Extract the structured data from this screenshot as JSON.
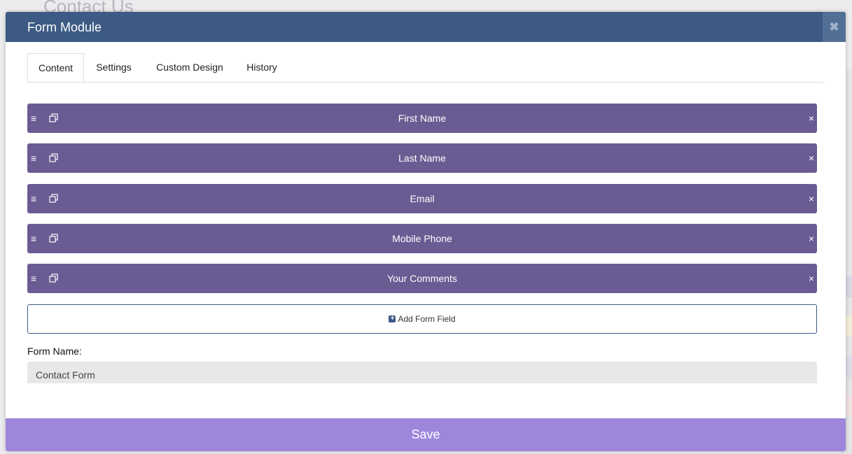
{
  "background": {
    "page_title": "Contact Us"
  },
  "modal": {
    "title": "Form Module",
    "close_label": "✖"
  },
  "tabs": [
    {
      "label": "Content",
      "active": true
    },
    {
      "label": "Settings",
      "active": false
    },
    {
      "label": "Custom Design",
      "active": false
    },
    {
      "label": "History",
      "active": false
    }
  ],
  "fields": [
    {
      "label": "First Name"
    },
    {
      "label": "Last Name"
    },
    {
      "label": "Email"
    },
    {
      "label": "Mobile Phone"
    },
    {
      "label": "Your Comments"
    }
  ],
  "field_controls": {
    "drag_icon": "≡",
    "remove_icon": "×"
  },
  "add_field": {
    "label": "Add Form Field"
  },
  "form_name": {
    "label": "Form Name:",
    "value": "Contact Form"
  },
  "save": {
    "label": "Save"
  },
  "colors": {
    "header": "#3c5a83",
    "field_row": "#6b5b93",
    "save_bar": "#9d86db"
  }
}
